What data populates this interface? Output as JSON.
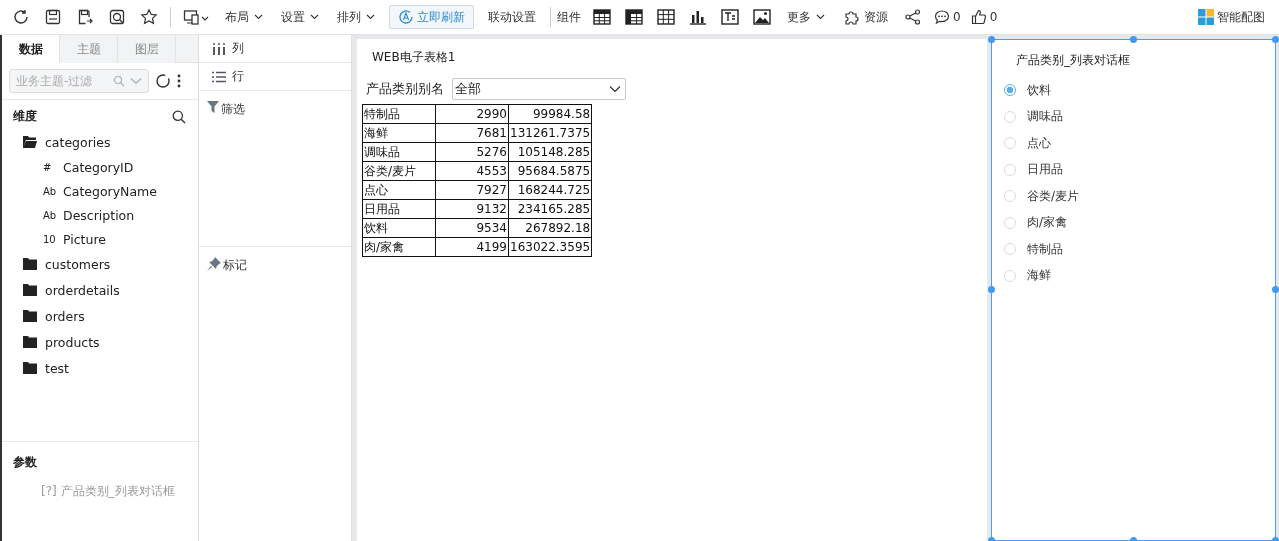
{
  "toolbar": {
    "menus": [
      {
        "label": "布局"
      },
      {
        "label": "设置"
      },
      {
        "label": "排列"
      }
    ],
    "refresh_button": "立即刷新",
    "link_settings": "联动设置",
    "components_label": "组件",
    "more_menu": "更多",
    "resources": "资源",
    "comments": "0",
    "likes": "0",
    "smart_colors": "智能配图"
  },
  "sidebar": {
    "tabs": [
      {
        "label": "数据",
        "selected": true
      },
      {
        "label": "主题",
        "selected": false
      },
      {
        "label": "图层",
        "selected": false
      }
    ],
    "search": {
      "placeholder": "业务主题-过滤"
    },
    "dimensions_title": "维度",
    "tree": [
      {
        "name": "categories",
        "expanded": true,
        "children": [
          {
            "name": "CategoryID",
            "type_label": "#"
          },
          {
            "name": "CategoryName",
            "type_label": "Ab"
          },
          {
            "name": "Description",
            "type_label": "Ab"
          },
          {
            "name": "Picture",
            "type_label": "10"
          }
        ]
      },
      {
        "name": "customers",
        "expanded": false
      },
      {
        "name": "orderdetails",
        "expanded": false
      },
      {
        "name": "orders",
        "expanded": false
      },
      {
        "name": "products",
        "expanded": false
      },
      {
        "name": "test",
        "expanded": false
      }
    ],
    "params_title": "参数",
    "params": [
      {
        "mark": "[?]",
        "name": "产品类别_列表对话框"
      }
    ]
  },
  "shelves": {
    "columns": "列",
    "rows": "行",
    "filter": "筛选",
    "marks": "标记"
  },
  "spreadsheet": {
    "title": "WEB电子表格1",
    "filter_label": "产品类别别名",
    "filter_value": "全部",
    "rows": [
      [
        "特制品",
        "2990",
        "99984.58"
      ],
      [
        "海鲜",
        "7681",
        "131261.7375"
      ],
      [
        "调味品",
        "5276",
        "105148.285"
      ],
      [
        "谷类/麦片",
        "4553",
        "95684.5875"
      ],
      [
        "点心",
        "7927",
        "168244.725"
      ],
      [
        "日用品",
        "9132",
        "234165.285"
      ],
      [
        "饮料",
        "9534",
        "267892.18"
      ],
      [
        "肉/家禽",
        "4199",
        "163022.3595"
      ]
    ]
  },
  "list_dialog": {
    "title": "产品类别_列表对话框",
    "options": [
      {
        "label": "饮料",
        "selected": true
      },
      {
        "label": "调味品",
        "selected": false
      },
      {
        "label": "点心",
        "selected": false
      },
      {
        "label": "日用品",
        "selected": false
      },
      {
        "label": "谷类/麦片",
        "selected": false
      },
      {
        "label": "肉/家禽",
        "selected": false
      },
      {
        "label": "特制品",
        "selected": false
      },
      {
        "label": "海鲜",
        "selected": false
      }
    ]
  }
}
